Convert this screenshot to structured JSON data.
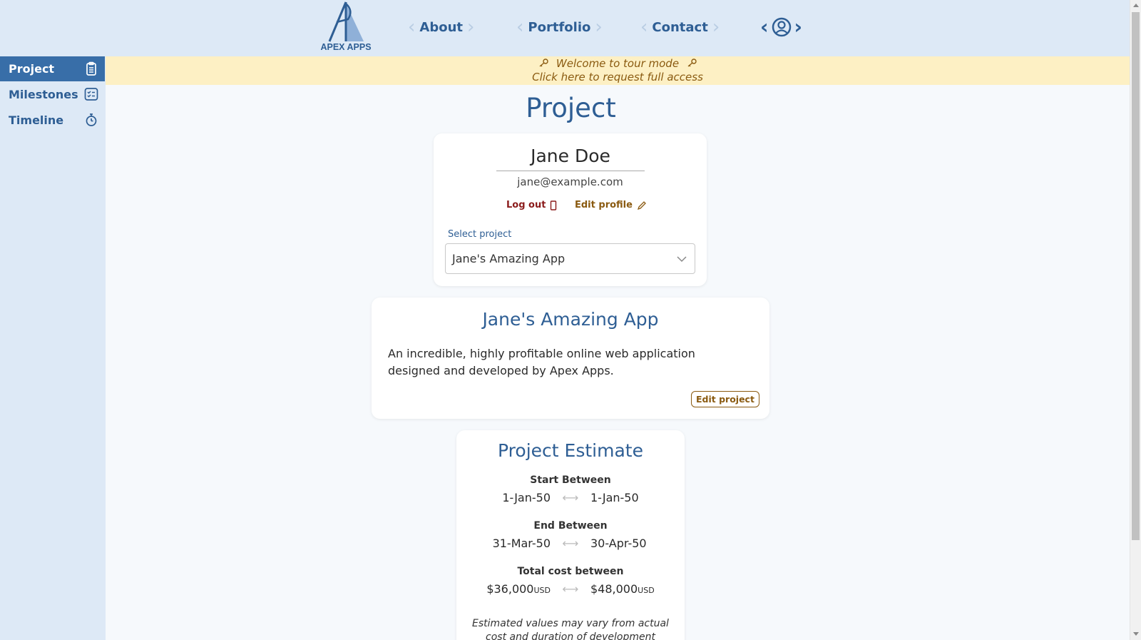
{
  "nav": {
    "logo_text": "APEX APPS",
    "links": [
      {
        "label": "About"
      },
      {
        "label": "Portfolio"
      },
      {
        "label": "Contact"
      }
    ],
    "account_icon": "user-circle-icon"
  },
  "sidebar": {
    "items": [
      {
        "label": "Project",
        "icon": "clipboard-icon",
        "active": true
      },
      {
        "label": "Milestones",
        "icon": "checklist-icon",
        "active": false
      },
      {
        "label": "Timeline",
        "icon": "stopwatch-icon",
        "active": false
      }
    ]
  },
  "banner": {
    "line1": "Welcome to tour mode",
    "line2": "Click here to request full access",
    "icon": "key-icon"
  },
  "page": {
    "title": "Project"
  },
  "user": {
    "name": "Jane Doe",
    "email": "jane@example.com",
    "logout_label": "Log out",
    "edit_profile_label": "Edit profile",
    "select_label": "Select project",
    "selected_project": "Jane's Amazing App"
  },
  "project": {
    "title": "Jane's Amazing App",
    "description": "An incredible, highly profitable online web application designed and developed by Apex Apps.",
    "edit_label": "Edit project"
  },
  "estimate": {
    "title": "Project Estimate",
    "start_heading": "Start Between",
    "start_from": "1-Jan-50",
    "start_to": "1-Jan-50",
    "end_heading": "End Between",
    "end_from": "31-Mar-50",
    "end_to": "30-Apr-50",
    "cost_heading": "Total cost between",
    "cost_from": "$36,000",
    "cost_to": "$48,000",
    "currency": "USD",
    "range_arrow": "⟷",
    "note": "Estimated values may vary from actual cost and duration of development"
  },
  "colors": {
    "brand": "#2e5e94",
    "nav_bg": "#dde9f6",
    "active_bg": "#386ea8",
    "banner_bg": "#fdf0c4",
    "accent_brown": "#8a5a10",
    "danger": "#8b1b1b"
  }
}
